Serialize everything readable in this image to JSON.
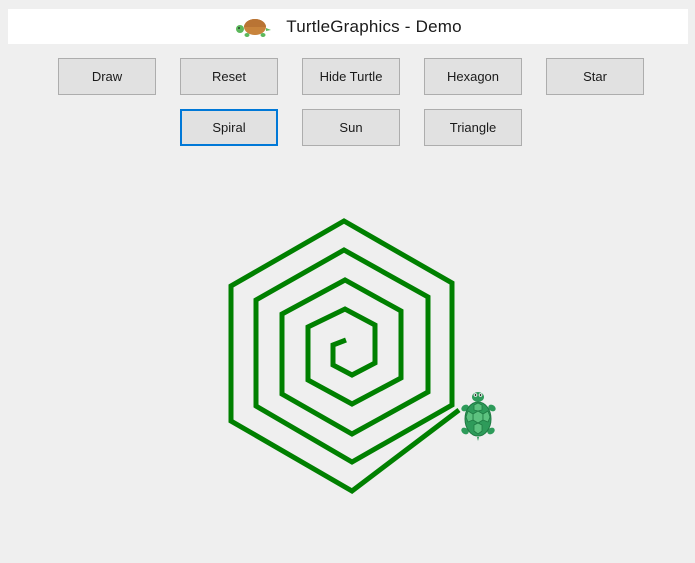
{
  "window": {
    "title": "TurtleGraphics - Demo"
  },
  "buttons": [
    {
      "id": "draw",
      "label": "Draw"
    },
    {
      "id": "reset",
      "label": "Reset"
    },
    {
      "id": "hide-turtle",
      "label": "Hide Turtle"
    },
    {
      "id": "hexagon",
      "label": "Hexagon"
    },
    {
      "id": "star",
      "label": "Star"
    },
    {
      "id": "spiral",
      "label": "Spiral",
      "focused": true
    },
    {
      "id": "sun",
      "label": "Sun"
    },
    {
      "id": "triangle",
      "label": "Triangle"
    }
  ],
  "drawing": {
    "shape": "hexagonal spiral",
    "pen_color": "#008000",
    "turtle_icon": "turtle-icon",
    "turtle_color": "#2e9b5a"
  },
  "colors": {
    "background": "#efefef",
    "button_face": "#e1e1e1",
    "focus_border": "#0078d7"
  }
}
